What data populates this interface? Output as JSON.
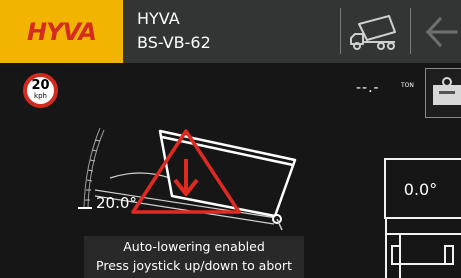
{
  "header": {
    "brand_logo": "HYVA",
    "device_name": "HYVA",
    "device_id": "BS-VB-62",
    "truck_view_icon": "tipper-truck-icon",
    "back_icon": "arrow-left-icon"
  },
  "speed_limit": {
    "value": "20",
    "unit": "kph"
  },
  "weight": {
    "value": "--.-",
    "unit": "TON",
    "scale_icon": "weighing-scale-icon"
  },
  "tipping": {
    "body_angle": "20.0°",
    "tilt_angle": "0.0°",
    "warning_icon": "warning-arrow-down-icon"
  },
  "status": {
    "line1": "Auto-lowering enabled",
    "line2": "Press joystick up/down to abort"
  },
  "colors": {
    "brand_yellow": "#f2b400",
    "brand_red": "#d52b1e",
    "warning_red": "#e02a20",
    "header_bg": "#333434",
    "screen_bg": "#161616"
  }
}
